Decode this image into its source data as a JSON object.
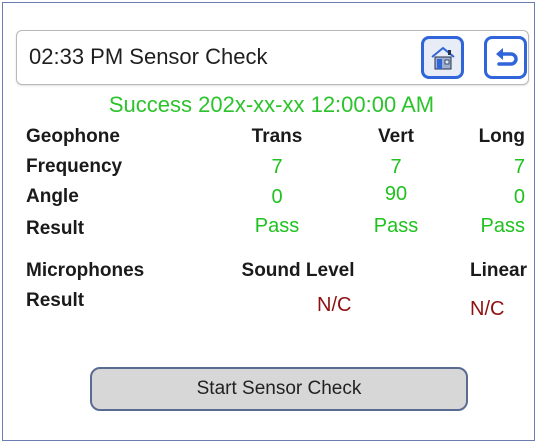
{
  "header": {
    "title": "02:33 PM  Sensor Check",
    "home_icon": "home-icon",
    "back_icon": "back-arrow-icon"
  },
  "status": {
    "text": "Success 202x-xx-xx 12:00:00 AM",
    "color": "#2cc32c"
  },
  "geophone": {
    "label": "Geophone",
    "columns": [
      "Trans",
      "Vert",
      "Long"
    ],
    "frequency_label": "Frequency",
    "frequency": [
      "7",
      "7",
      "7"
    ],
    "angle_label": "Angle",
    "angle": [
      "0",
      "90",
      "0"
    ],
    "result_label": "Result",
    "result": [
      "Pass",
      "Pass",
      "Pass"
    ]
  },
  "microphones": {
    "label": "Microphones",
    "columns": [
      "Sound Level",
      "Linear"
    ],
    "result_label": "Result",
    "result": [
      "N/C",
      "N/C"
    ]
  },
  "actions": {
    "start_label": "Start Sensor Check"
  },
  "colors": {
    "accent": "#2f65d8",
    "pass": "#1fc21f",
    "nc": "#8f1010",
    "border": "#6a7fb0"
  }
}
